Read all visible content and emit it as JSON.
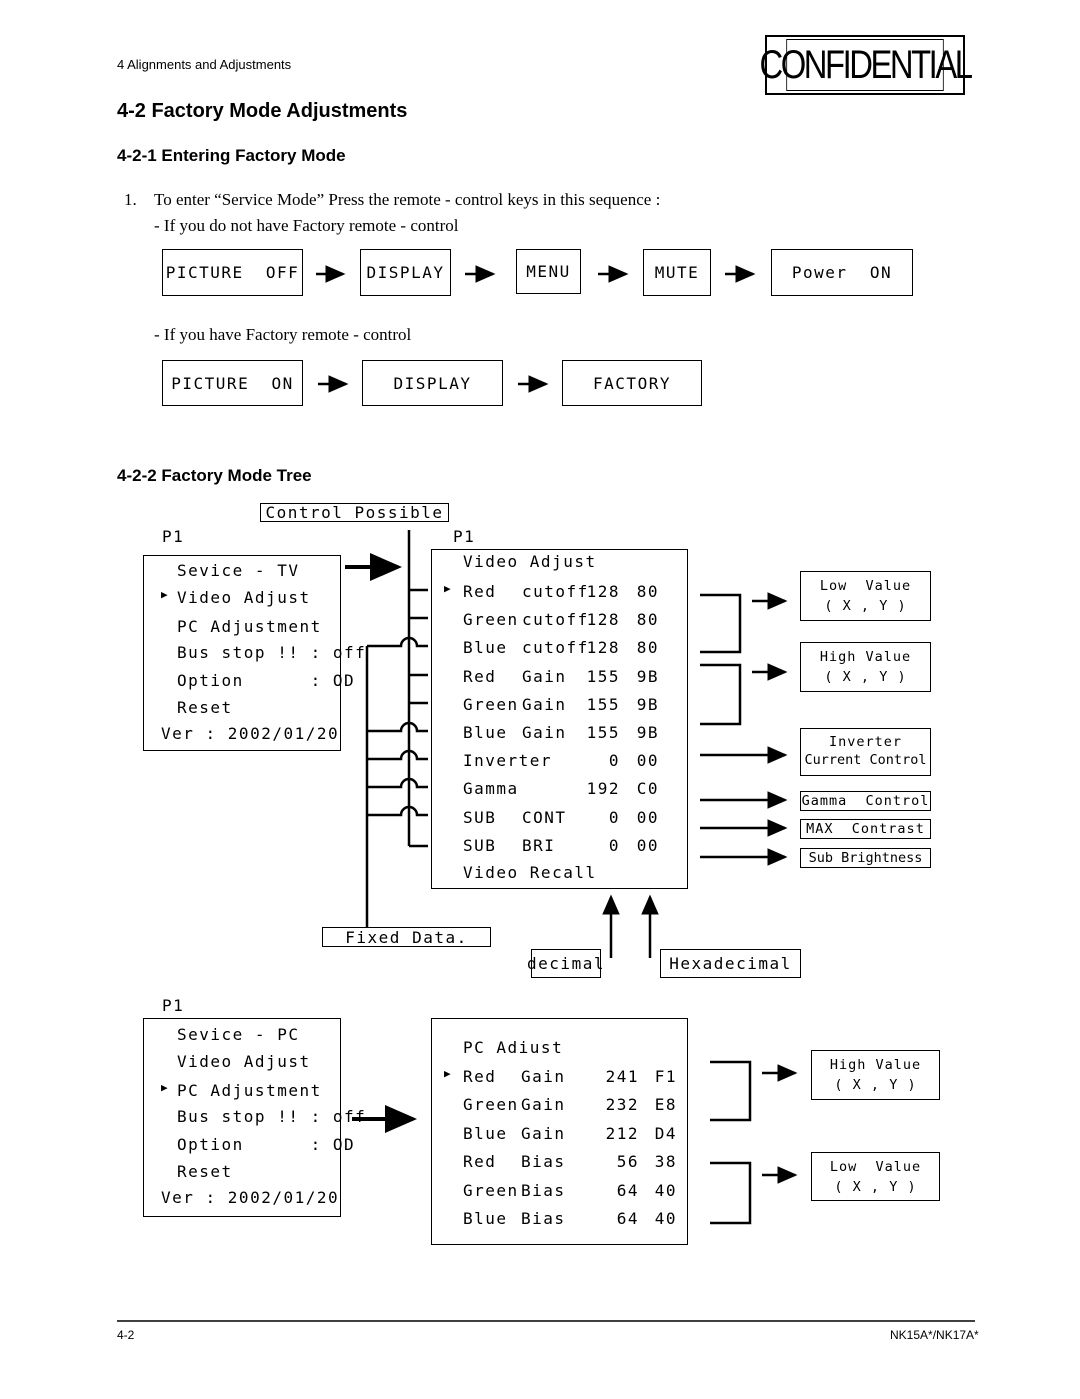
{
  "header": {
    "section": "4 Alignments and Adjustments",
    "logo": "CONFIDENTIAL"
  },
  "title": "4-2 Factory Mode Adjustments",
  "sub1": "4-2-1 Entering Factory Mode",
  "step1": "1.",
  "step1_text": "To enter “Service Mode” Press the remote - control keys in this sequence :",
  "no_factory": "- If you do not have Factory remote - control",
  "seq1": [
    "PICTURE  OFF",
    "DISPLAY",
    "MENU",
    "MUTE",
    "Power  ON"
  ],
  "has_factory": "- If you have Factory remote - control",
  "seq2": [
    "PICTURE  ON",
    "DISPLAY",
    "FACTORY"
  ],
  "sub2": "4-2-2 Factory Mode Tree",
  "tree": {
    "control_possible": "Control Possible",
    "p1": "P1",
    "fixed_data": "Fixed Data.",
    "decimal": "decimal",
    "hexadecimal": "Hexadecimal",
    "tv_menu": [
      "Sevice - TV",
      "Video Adjust",
      "PC Adjustment",
      "Bus stop !! : off",
      "Option      : OD",
      "Reset",
      "Ver : 2002/01/20"
    ],
    "pc_menu": [
      "Sevice - PC",
      "Video Adjust",
      "PC Adjustment",
      "Bus stop !! : off",
      "Option      : OD",
      "Reset",
      "Ver : 2002/01/20"
    ],
    "video_title": "Video Adjust",
    "video_rows": [
      [
        "Red",
        "cutoff",
        "128",
        "80"
      ],
      [
        "Green",
        "cutoff",
        "128",
        "80"
      ],
      [
        "Blue",
        "cutoff",
        "128",
        "80"
      ],
      [
        "Red",
        "Gain",
        "155",
        "9B"
      ],
      [
        "Green",
        "Gain",
        "155",
        "9B"
      ],
      [
        "Blue",
        "Gain",
        "155",
        "9B"
      ],
      [
        "Inverter",
        "",
        "0",
        "00"
      ],
      [
        "Gamma",
        "",
        "192",
        "C0"
      ],
      [
        "SUB",
        "CONT",
        "0",
        "00"
      ],
      [
        "SUB",
        "BRI",
        "0",
        "00"
      ]
    ],
    "video_recall": "Video Recall",
    "pc_title": "PC Adiust",
    "pc_rows": [
      [
        "Red",
        "Gain",
        "241",
        "F1"
      ],
      [
        "Green",
        "Gain",
        "232",
        "E8"
      ],
      [
        "Blue",
        "Gain",
        "212",
        "D4"
      ],
      [
        "Red",
        "Bias",
        "56",
        "38"
      ],
      [
        "Green",
        "Bias",
        "64",
        "40"
      ],
      [
        "Blue",
        "Bias",
        "64",
        "40"
      ]
    ],
    "notes": {
      "low": "Low  Value",
      "high": "High Value",
      "xy": "( X , Y )",
      "inv1": "Inverter",
      "inv2": "Current Control",
      "gamma": "Gamma  Control",
      "max": "MAX  Contrast",
      "subb": "Sub Brightness"
    }
  },
  "footer": {
    "page": "4-2",
    "model": "NK15A*/NK17A*"
  }
}
